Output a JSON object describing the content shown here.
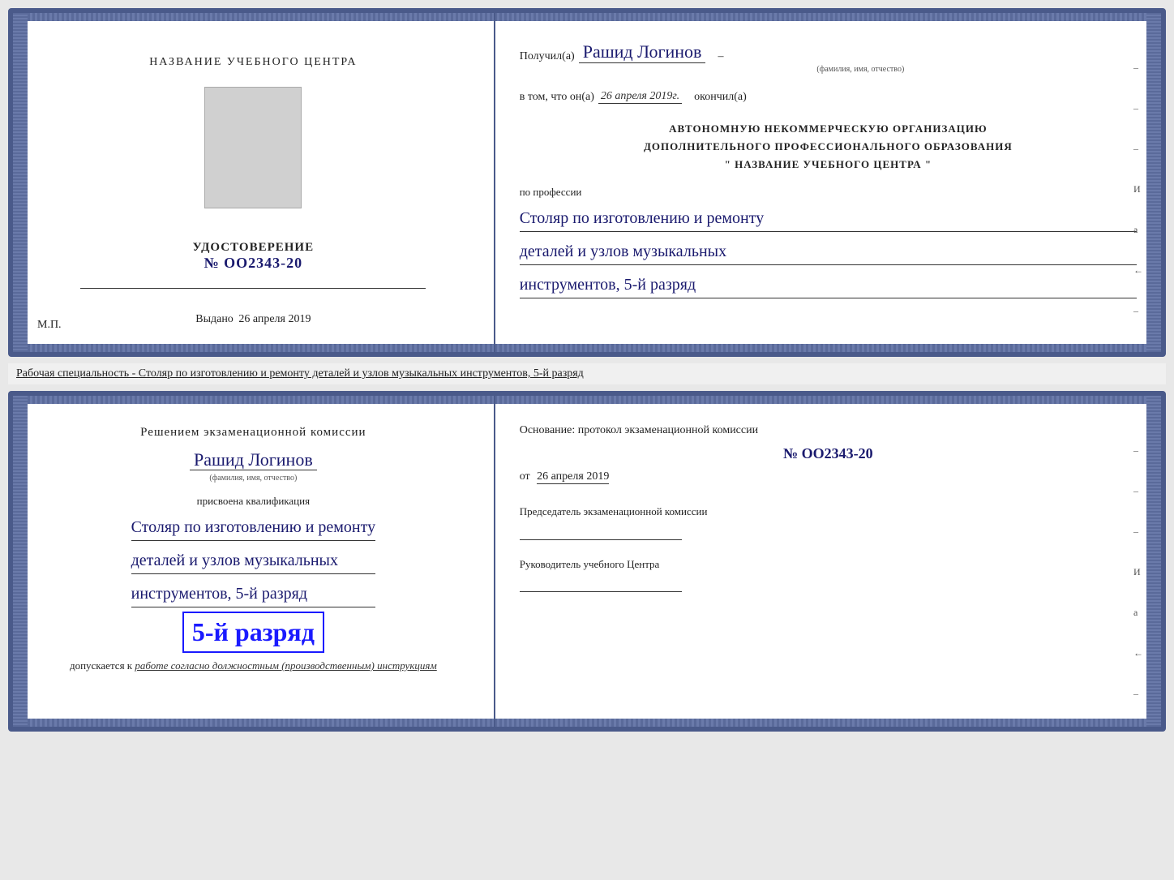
{
  "topCard": {
    "left": {
      "centerTitle": "НАЗВАНИЕ УЧЕБНОГО ЦЕНТРА",
      "udostoverenie": "УДОСТОВЕРЕНИЕ",
      "number": "№ OO2343-20",
      "vydanoLabel": "Выдано",
      "vydanoDate": "26 апреля 2019",
      "mp": "М.П."
    },
    "right": {
      "poluchilLabel": "Получил(a)",
      "recipientName": "Рашид Логинов",
      "fioSub": "(фамилия, имя, отчество)",
      "dashAfterName": "–",
      "vtomLabel": "в том, что он(а)",
      "date": "26 апреля 2019г.",
      "okonchilLabel": "окончил(а)",
      "orgLine1": "АВТОНОМНУЮ НЕКОММЕРЧЕСКУЮ ОРГАНИЗАЦИЮ",
      "orgLine2": "ДОПОЛНИТЕЛЬНОГО ПРОФЕССИОНАЛЬНОГО ОБРАЗОВАНИЯ",
      "orgLine3": "\"  НАЗВАНИЕ УЧЕБНОГО ЦЕНТРА  \"",
      "poprofessiiLabel": "по профессии",
      "profession1": "Столяр по изготовлению и ремонту",
      "profession2": "деталей и узлов музыкальных",
      "profession3": "инструментов, 5-й разряд",
      "rightMarkers": [
        "-",
        "-",
        "-",
        "И",
        "а",
        "←",
        "-",
        "-",
        "-"
      ]
    }
  },
  "specialtyText": "Рабочая специальность - Столяр по изготовлению и ремонту деталей и узлов музыкальных инструментов, 5-й разряд",
  "bottomCard": {
    "left": {
      "resheniemTitle": "Решением экзаменационной комиссии",
      "recipientName": "Рашид Логинов",
      "fioSub": "(фамилия, имя, отчество)",
      "prisvoenoLabel": "присвоена квалификация",
      "profession1": "Столяр по изготовлению и ремонту",
      "profession2": "деталей и узлов музыкальных",
      "profession3": "инструментов, 5-й разряд",
      "razryadBig": "5-й разряд",
      "dopuskaetsyaLabel": "допускается к",
      "dopuskaetsyaText": "работе согласно должностным (производственным) инструкциям"
    },
    "right": {
      "osnovaLabel": "Основание: протокол экзаменационной комиссии",
      "number": "№  OO2343-20",
      "otLabel": "от",
      "date": "26 апреля 2019",
      "predsedatelLabel": "Председатель экзаменационной комиссии",
      "rukovoditelLabel": "Руководитель учебного Центра",
      "rightMarkers": [
        "-",
        "-",
        "-",
        "И",
        "а",
        "←",
        "-",
        "-",
        "-"
      ]
    }
  }
}
